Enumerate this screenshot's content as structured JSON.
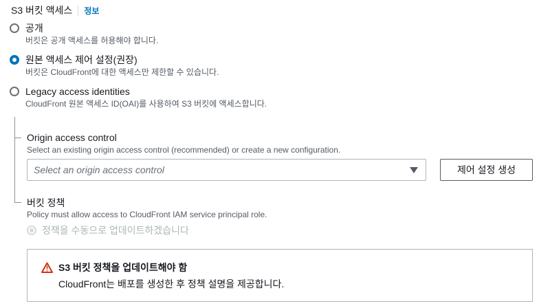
{
  "section": {
    "title": "S3 버킷 액세스",
    "info_link": "정보"
  },
  "access_options": [
    {
      "label": "공개",
      "description": "버킷은 공개 액세스를 허용해야 합니다.",
      "selected": false
    },
    {
      "label": "원본 액세스 제어 설정(권장)",
      "description": "버킷은 CloudFront에 대한 액세스만 제한할 수 있습니다.",
      "selected": true
    },
    {
      "label": "Legacy access identities",
      "description": "CloudFront 원본 액세스 ID(OAI)를 사용하여 S3 버킷에 액세스합니다.",
      "selected": false
    }
  ],
  "origin_access_control": {
    "label": "Origin access control",
    "description": "Select an existing origin access control (recommended) or create a new configuration.",
    "select_placeholder": "Select an origin access control",
    "create_button": "제어 설정 생성"
  },
  "bucket_policy": {
    "label": "버킷 정책",
    "description": "Policy must allow access to CloudFront IAM service principal role.",
    "manual_update_option": "정책을 수동으로 업데이트하겠습니다"
  },
  "alert": {
    "type": "warning",
    "title": "S3 버킷 정책을 업데이트해야 함",
    "body": "CloudFront는 배포를 생성한 후 정책 설명을 제공합니다.",
    "icon_color": "#d13212"
  },
  "colors": {
    "accent": "#0073bb",
    "text": "#16191f",
    "secondary_text": "#545b64",
    "border": "#aab7b8",
    "warning": "#d13212"
  }
}
